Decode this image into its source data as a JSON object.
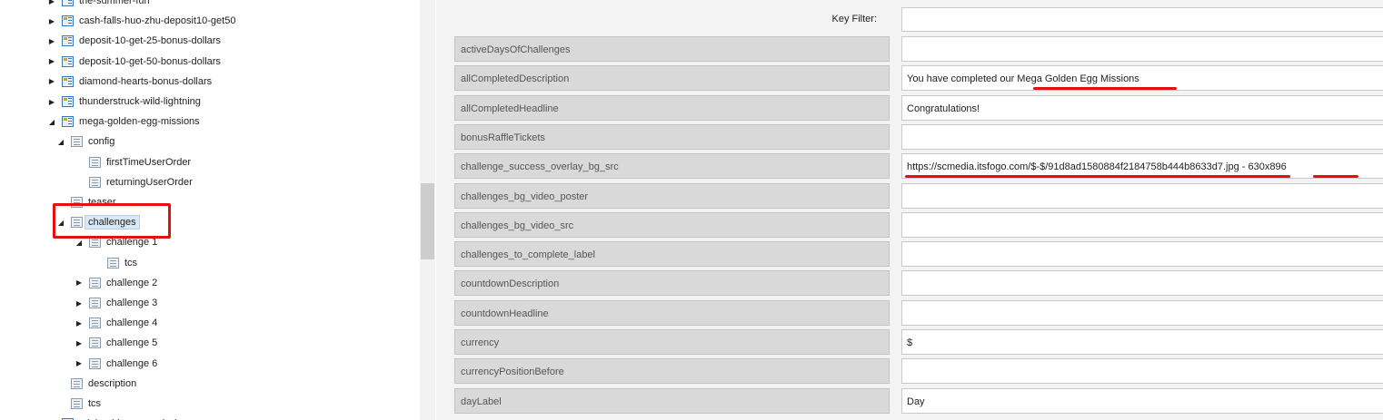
{
  "tree": {
    "items": [
      {
        "label": "the-summer-fun",
        "toggle": "▶",
        "icon": "cfg"
      },
      {
        "label": "cash-falls-huo-zhu-deposit10-get50",
        "toggle": "▶",
        "icon": "cfg"
      },
      {
        "label": "deposit-10-get-25-bonus-dollars",
        "toggle": "▶",
        "icon": "cfg"
      },
      {
        "label": "deposit-10-get-50-bonus-dollars",
        "toggle": "▶",
        "icon": "cfg"
      },
      {
        "label": "diamond-hearts-bonus-dollars",
        "toggle": "▶",
        "icon": "cfg"
      },
      {
        "label": "thunderstruck-wild-lightning",
        "toggle": "▶",
        "icon": "cfg"
      },
      {
        "label": "mega-golden-egg-missions",
        "toggle": "◢",
        "icon": "cfg"
      },
      {
        "label": "config",
        "toggle": "◢",
        "icon": "doc"
      },
      {
        "label": "firstTimeUserOrder",
        "toggle": "",
        "icon": "doc"
      },
      {
        "label": "returningUserOrder",
        "toggle": "",
        "icon": "doc"
      },
      {
        "label": "teaser",
        "toggle": "",
        "icon": "doc"
      },
      {
        "label": "challenges",
        "toggle": "◢",
        "icon": "doc",
        "selected": true
      },
      {
        "label": "challenge 1",
        "toggle": "◢",
        "icon": "doc"
      },
      {
        "label": "tcs",
        "toggle": "",
        "icon": "doc"
      },
      {
        "label": "challenge 2",
        "toggle": "▶",
        "icon": "doc"
      },
      {
        "label": "challenge 3",
        "toggle": "▶",
        "icon": "doc"
      },
      {
        "label": "challenge 4",
        "toggle": "▶",
        "icon": "doc"
      },
      {
        "label": "challenge 5",
        "toggle": "▶",
        "icon": "doc"
      },
      {
        "label": "challenge 6",
        "toggle": "▶",
        "icon": "doc"
      },
      {
        "label": "description",
        "toggle": "",
        "icon": "doc"
      },
      {
        "label": "tcs",
        "toggle": "",
        "icon": "doc"
      },
      {
        "label": "mini-golden-egg-missions",
        "toggle": "▶",
        "icon": "cfg"
      }
    ]
  },
  "filter": {
    "label": "Key Filter:",
    "value": ""
  },
  "rows": [
    {
      "key": "activeDaysOfChallenges",
      "value": ""
    },
    {
      "key": "allCompletedDescription",
      "value": "You have completed our Mega Golden Egg Missions"
    },
    {
      "key": "allCompletedHeadline",
      "value": "Congratulations!"
    },
    {
      "key": "bonusRaffleTickets",
      "value": ""
    },
    {
      "key": "challenge_success_overlay_bg_src",
      "value": "https://scmedia.itsfogo.com/$-$/91d8ad1580884f2184758b444b8633d7.jpg  -  630x896"
    },
    {
      "key": "challenges_bg_video_poster",
      "value": ""
    },
    {
      "key": "challenges_bg_video_src",
      "value": ""
    },
    {
      "key": "challenges_to_complete_label",
      "value": ""
    },
    {
      "key": "countdownDescription",
      "value": ""
    },
    {
      "key": "countdownHeadline",
      "value": ""
    },
    {
      "key": "currency",
      "value": "$"
    },
    {
      "key": "currencyPositionBefore",
      "value": ""
    },
    {
      "key": "dayLabel",
      "value": "Day"
    }
  ],
  "colors": {
    "highlight": "#e41010",
    "selected_bg": "#d8e8f6"
  }
}
